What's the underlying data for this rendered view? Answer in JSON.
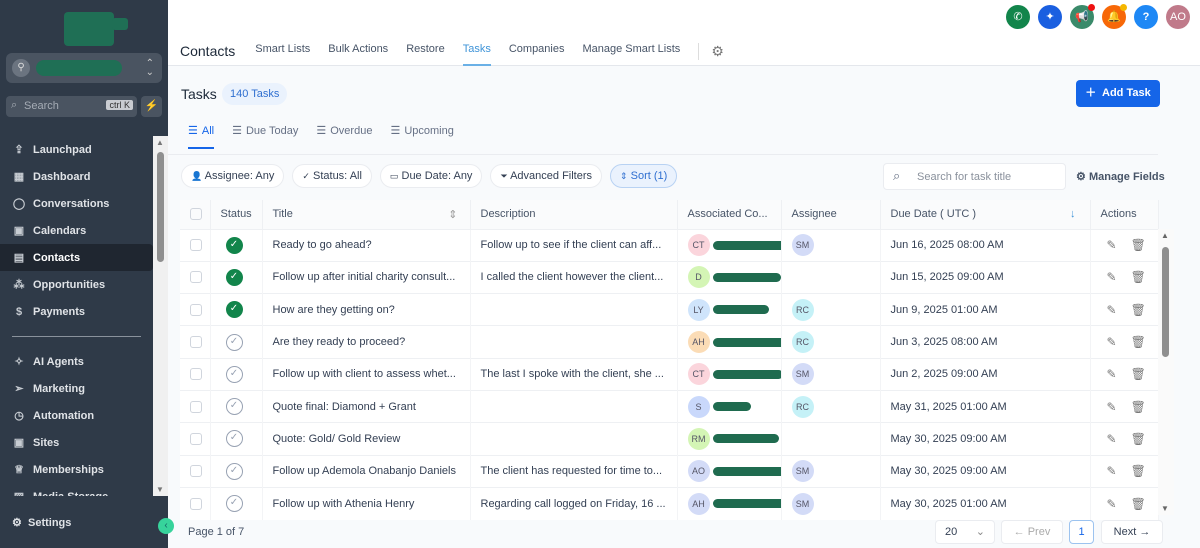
{
  "sidebar": {
    "search_placeholder": "Search",
    "shortcut": "ctrl K",
    "items": [
      {
        "label": "Launchpad",
        "icon": "rocket-icon"
      },
      {
        "label": "Dashboard",
        "icon": "grid-icon"
      },
      {
        "label": "Conversations",
        "icon": "chat-icon"
      },
      {
        "label": "Calendars",
        "icon": "calendar-icon"
      },
      {
        "label": "Contacts",
        "icon": "contacts-icon"
      },
      {
        "label": "Opportunities",
        "icon": "opportunities-icon"
      },
      {
        "label": "Payments",
        "icon": "payments-icon"
      }
    ],
    "items2": [
      {
        "label": "AI Agents"
      },
      {
        "label": "Marketing"
      },
      {
        "label": "Automation"
      },
      {
        "label": "Sites"
      },
      {
        "label": "Memberships"
      },
      {
        "label": "Media Storage"
      }
    ],
    "settings": "Settings"
  },
  "header": {
    "title": "Contacts",
    "tabs": [
      "Smart Lists",
      "Bulk Actions",
      "Restore",
      "Tasks",
      "Companies",
      "Manage Smart Lists"
    ],
    "active_tab": "Tasks",
    "user_initials": "AO",
    "help": "?"
  },
  "page": {
    "title": "Tasks",
    "count": "140 Tasks",
    "add_label": "Add Task",
    "filter_tabs": [
      "All",
      "Due Today",
      "Overdue",
      "Upcoming"
    ],
    "pills": [
      "Assignee: Any",
      "Status: All",
      "Due Date: Any",
      "Advanced Filters",
      "Sort (1)"
    ],
    "search_placeholder": "Search for task title",
    "manage_fields": "Manage Fields"
  },
  "table": {
    "columns": [
      "Status",
      "Title",
      "Description",
      "Associated Co...",
      "Assignee",
      "Due Date ( UTC )",
      "Actions"
    ],
    "rows": [
      {
        "done": true,
        "title": "Ready to go ahead?",
        "desc": "Follow up to see if the client can aff...",
        "contact": "CT",
        "ccol": "#fbd5dc",
        "assignee": "SM",
        "acol": "#d3dbf7",
        "due": "Jun 16, 2025 08:00 AM"
      },
      {
        "done": true,
        "title": "Follow up after initial charity consult...",
        "desc": "I called the client however the client...",
        "contact": "D",
        "ccol": "#d4f5b5",
        "assignee": "",
        "acol": "",
        "due": "Jun 15, 2025 09:00 AM"
      },
      {
        "done": true,
        "title": "How are they getting on?",
        "desc": "",
        "contact": "LY",
        "ccol": "#cfe4fb",
        "assignee": "RC",
        "acol": "#c5f1f7",
        "due": "Jun 9, 2025 01:00 AM"
      },
      {
        "done": false,
        "title": "Are they ready to proceed?",
        "desc": "",
        "contact": "AH",
        "ccol": "#fbdcb6",
        "assignee": "RC",
        "acol": "#c5f1f7",
        "due": "Jun 3, 2025 08:00 AM"
      },
      {
        "done": false,
        "title": "Follow up with client to assess whet...",
        "desc": "The last I spoke with the client, she ...",
        "contact": "CT",
        "ccol": "#fbd5dc",
        "assignee": "SM",
        "acol": "#d3dbf7",
        "due": "Jun 2, 2025 09:00 AM"
      },
      {
        "done": false,
        "title": "Quote final: Diamond + Grant",
        "desc": "",
        "contact": "S",
        "ccol": "#c9d8fb",
        "assignee": "RC",
        "acol": "#c5f1f7",
        "due": "May 31, 2025 01:00 AM"
      },
      {
        "done": false,
        "title": "Quote: Gold/ Gold Review",
        "desc": "",
        "contact": "RM",
        "ccol": "#d4f5b5",
        "assignee": "",
        "acol": "",
        "due": "May 30, 2025 09:00 AM"
      },
      {
        "done": false,
        "title": "Follow up Ademola Onabanjo Daniels",
        "desc": "The client has requested for time to...",
        "contact": "AO",
        "ccol": "#d3dbf7",
        "assignee": "SM",
        "acol": "#d3dbf7",
        "due": "May 30, 2025 09:00 AM"
      },
      {
        "done": false,
        "title": "Follow up with Athenia Henry",
        "desc": "Regarding call logged on Friday, 16 ...",
        "contact": "AH",
        "ccol": "#d3dbf7",
        "assignee": "SM",
        "acol": "#d3dbf7",
        "due": "May 30, 2025 01:00 AM"
      }
    ]
  },
  "pagination": {
    "label": "Page 1 of 7",
    "page_size": "20",
    "prev": "Prev",
    "current": "1",
    "next": "Next"
  }
}
